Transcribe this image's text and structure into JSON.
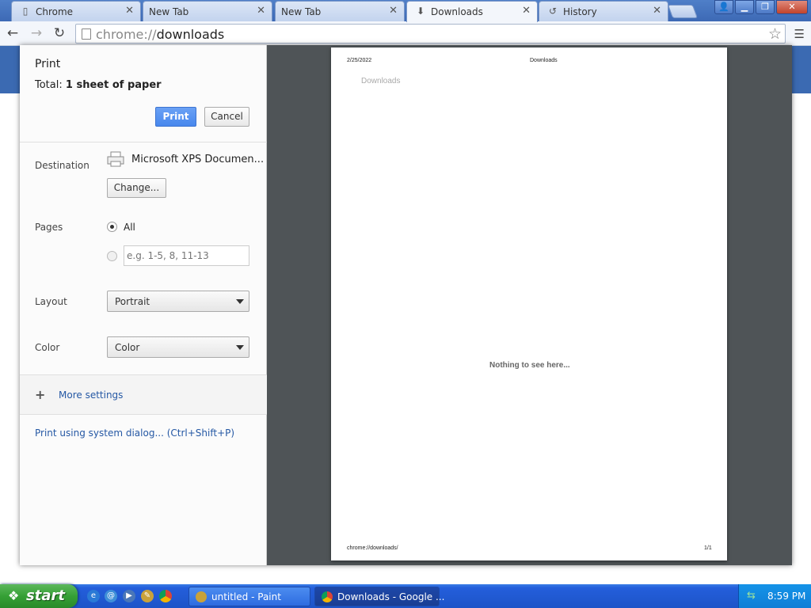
{
  "tabs": [
    {
      "label": "Chrome",
      "icon": "page-icon"
    },
    {
      "label": "New Tab",
      "icon": "page-icon"
    },
    {
      "label": "New Tab",
      "icon": "page-icon"
    },
    {
      "label": "Downloads",
      "icon": "download-icon",
      "active": true
    },
    {
      "label": "History",
      "icon": "history-icon"
    }
  ],
  "omnibox": {
    "scheme": "chrome://",
    "path": "downloads"
  },
  "print": {
    "title": "Print",
    "total_label": "Total:",
    "total_value": "1 sheet of paper",
    "print_button": "Print",
    "cancel_button": "Cancel",
    "destination_label": "Destination",
    "destination_value": "Microsoft XPS Documen...",
    "change_button": "Change...",
    "pages_label": "Pages",
    "pages_all": "All",
    "pages_placeholder": "e.g. 1-5, 8, 11-13",
    "layout_label": "Layout",
    "layout_value": "Portrait",
    "color_label": "Color",
    "color_value": "Color",
    "more_settings": "More settings",
    "system_dialog": "Print using system dialog... (Ctrl+Shift+P)"
  },
  "preview": {
    "date": "2/25/2022",
    "header_title": "Downloads",
    "heading": "Downloads",
    "empty_message": "Nothing to see here...",
    "footer_url": "chrome://downloads/",
    "page_number": "1/1"
  },
  "taskbar": {
    "start_label": "start",
    "items": [
      {
        "label": "untitled - Paint"
      },
      {
        "label": "Downloads - Google ...",
        "active": true
      }
    ],
    "clock": "8:59 PM"
  },
  "colors": {
    "accent": "#4787ed",
    "link": "#2558a4",
    "preview_bg": "#4f5457"
  }
}
